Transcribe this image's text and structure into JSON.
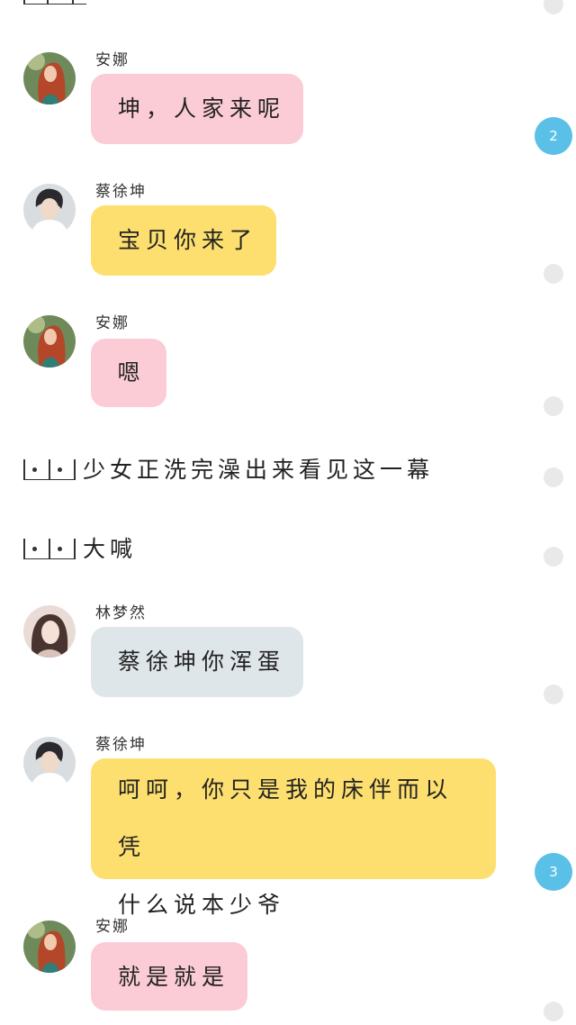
{
  "messages": [
    {
      "name": "安娜",
      "text": "坤，人家来呢",
      "avatar": "anna-avatar-icon"
    },
    {
      "name": "蔡徐坤",
      "text": "宝贝你来了",
      "avatar": "cai-avatar-icon"
    },
    {
      "name": "安娜",
      "text": "嗯",
      "avatar": "anna-avatar-icon"
    },
    {
      "name": "林梦然",
      "text": "蔡徐坤你浑蛋",
      "avatar": "lin-avatar-icon"
    },
    {
      "name": "蔡徐坤",
      "text_line1": "呵呵，你只是我的床伴而以凭",
      "text_line2": "什么说本少爷",
      "avatar": "cai-avatar-icon"
    },
    {
      "name": "安娜",
      "text": "就是就是",
      "avatar": "anna-avatar-icon"
    }
  ],
  "narrations": [
    {
      "text": "少女正洗完澡出来看见这一幕"
    },
    {
      "text": "大喊"
    }
  ],
  "badges": [
    "2",
    "3"
  ],
  "colors": {
    "pink_bubble": "#fcccd6",
    "yellow_bubble": "#fddf6f",
    "gray_bubble": "#dfe6ea",
    "badge": "#5bc0e8",
    "side_dot": "#e9e9e9"
  }
}
